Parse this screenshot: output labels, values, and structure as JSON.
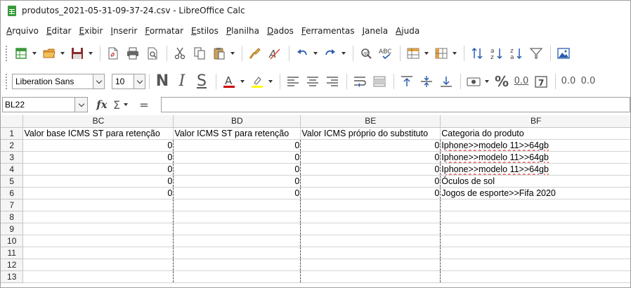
{
  "window": {
    "title": "produtos_2021-05-31-09-37-24.csv - LibreOffice Calc"
  },
  "menu": [
    "Arquivo",
    "Editar",
    "Exibir",
    "Inserir",
    "Formatar",
    "Estilos",
    "Planilha",
    "Dados",
    "Ferramentas",
    "Janela",
    "Ajuda"
  ],
  "toolbar_icons": {
    "standard": [
      "new-spreadsheet-icon",
      "open-folder-icon",
      "save-icon",
      "export-pdf-icon",
      "print-icon",
      "print-preview-icon",
      "cut-icon",
      "copy-icon",
      "paste-icon",
      "clone-formatting-icon",
      "clear-formatting-icon",
      "undo-icon",
      "redo-icon",
      "find-replace-icon",
      "spelling-icon",
      "row-icon",
      "column-icon",
      "sort-icon",
      "sort-ascending-icon",
      "sort-descending-icon",
      "autofilter-icon",
      "insert-image-icon"
    ],
    "formatting": [
      "bold-icon",
      "italic-icon",
      "underline-icon",
      "font-color-icon",
      "highlight-color-icon",
      "align-left-icon",
      "align-center-icon",
      "align-right-icon",
      "wrap-text-icon",
      "merge-cells-icon",
      "align-top-icon",
      "align-middle-icon",
      "align-bottom-icon",
      "currency-format-icon",
      "percent-format-icon",
      "number-format-icon",
      "date-format-icon",
      "add-decimal-icon",
      "delete-decimal-icon"
    ]
  },
  "formatting": {
    "font_name": "Liberation Sans",
    "font_size": "10",
    "bold": "N",
    "italic": "I",
    "underline": "S",
    "percent": "%",
    "number_format": "0.0",
    "decimal_add": "0.0",
    "decimal_del": "0.0",
    "font_color": "#cc0000",
    "highlight_color": "#ffff00"
  },
  "formula_bar": {
    "name_box": "BL22",
    "fx": "fx",
    "sigma": "Σ",
    "equals": "=",
    "content": ""
  },
  "sheet": {
    "columns": [
      "BC",
      "BD",
      "BE",
      "BF"
    ],
    "row_numbers": [
      "1",
      "2",
      "3",
      "4",
      "5",
      "6",
      "7",
      "8",
      "9",
      "10",
      "11",
      "12",
      "13"
    ],
    "header_row": [
      "Valor base ICMS ST para retenção",
      "Valor ICMS ST para retenção",
      "Valor ICMS próprio do substituto",
      "Categoria do produto"
    ],
    "data_rows": [
      [
        "0",
        "0",
        "0",
        "Iphone>>modelo 11>>64gb"
      ],
      [
        "0",
        "0",
        "0",
        "Iphone>>modelo 11>>64gb"
      ],
      [
        "0",
        "0",
        "0",
        "Iphone>>modelo 11>>64gb"
      ],
      [
        "0",
        "0",
        "0",
        "Óculos de sol"
      ],
      [
        "0",
        "0",
        "0",
        "Jogos de esporte>>Fifa 2020"
      ]
    ]
  }
}
